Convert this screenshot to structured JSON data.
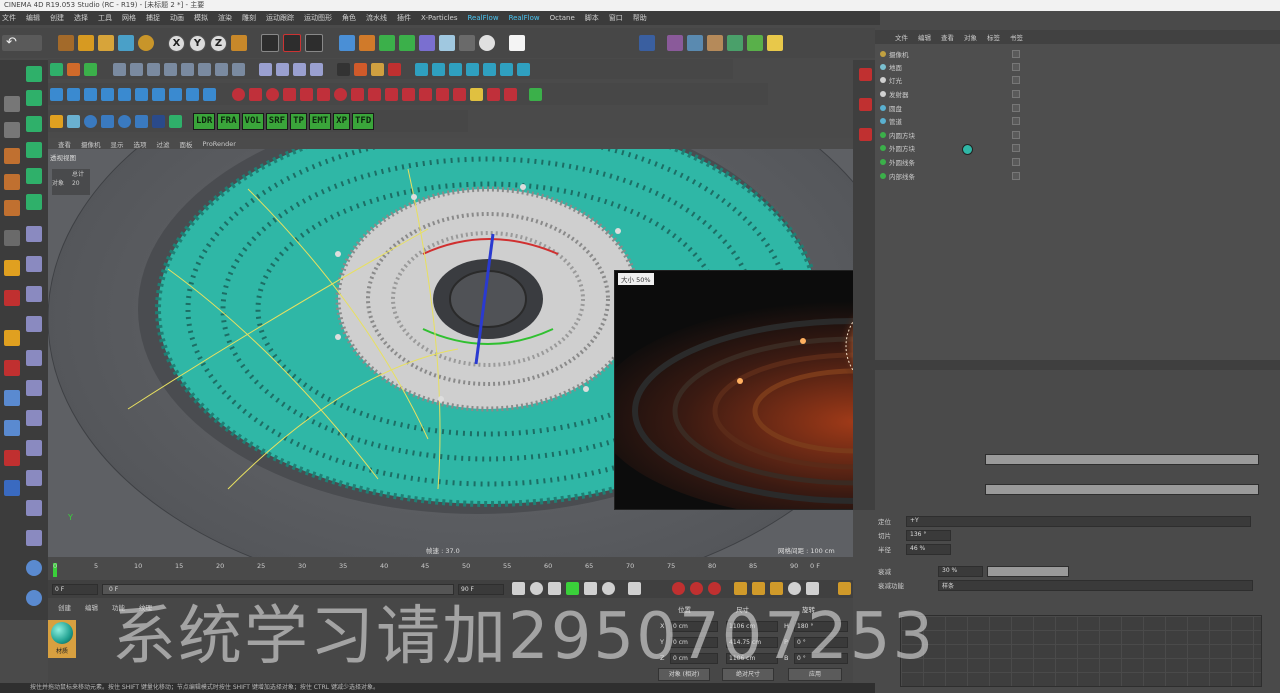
{
  "app": {
    "title": "CINEMA 4D R19.053 Studio (RC - R19) - [未标题 2 *] - 主要"
  },
  "menu": {
    "items": [
      "文件",
      "编辑",
      "创建",
      "选择",
      "工具",
      "网格",
      "捕捉",
      "动画",
      "模拟",
      "渲染",
      "雕刻",
      "运动跟踪",
      "运动图形",
      "角色",
      "流水线",
      "插件",
      "X-Particles",
      "RealFlow",
      "RealFlow",
      "Octane",
      "脚本",
      "窗口",
      "帮助"
    ]
  },
  "plugin_tags": [
    "LDR",
    "FRA",
    "VOL",
    "SRF",
    "TP",
    "EMT",
    "XP",
    "TFD"
  ],
  "axis_buttons": [
    "X",
    "Y",
    "Z"
  ],
  "viewport": {
    "menu": [
      "查看",
      "摄像机",
      "显示",
      "选项",
      "过滤",
      "面板",
      "ProRender"
    ],
    "view_label": "透视视图",
    "stats": {
      "label1": "总计",
      "label2": "对象",
      "value2": "20"
    },
    "speed_label": "帧速 : 37.0",
    "grid_label": "网格间距 : 100 cm",
    "axis_y": "Y"
  },
  "preview": {
    "label": "大小 50%"
  },
  "timeline": {
    "ticks": [
      "0",
      "5",
      "10",
      "15",
      "20",
      "25",
      "30",
      "35",
      "40",
      "45",
      "50",
      "55",
      "60",
      "65",
      "70",
      "75",
      "80",
      "85",
      "90"
    ],
    "end_frame": "0 F",
    "start_field": "0 F",
    "start_field2": "0 F",
    "end_field": "90 F"
  },
  "bottom": {
    "tabs": [
      "创建",
      "编辑",
      "功能",
      "纹理"
    ],
    "material_name": "材质",
    "coords": {
      "header": [
        "位置",
        "尺寸",
        "旋转"
      ],
      "rows": [
        {
          "axis": "X",
          "pos": "0 cm",
          "size": "1106 cm",
          "rot_label": "H",
          "rot": "180 °"
        },
        {
          "axis": "Y",
          "pos": "0 cm",
          "size": "414.75 cm",
          "rot_label": "P",
          "rot": "0 °"
        },
        {
          "axis": "Z",
          "pos": "0 cm",
          "size": "1106 cm",
          "rot_label": "B",
          "rot": "0 °"
        }
      ],
      "mode1": "对象 (相对)",
      "mode2": "绝对尺寸",
      "apply": "应用"
    }
  },
  "status_text": "按住并拖动鼠标来移动元素。按住 SHIFT 键量化移动；节点编辑模式时按住 SHIFT 键增加选择对象；按住 CTRL 键减少选择对象。",
  "object_manager": {
    "tabs": [
      "文件",
      "编辑",
      "查看",
      "对象",
      "标签",
      "书签"
    ],
    "objects": [
      "摄像机",
      "地面",
      "灯光",
      "发射器",
      "圆盘",
      "管道",
      "内圆方块",
      "外圆方块",
      "外圆线条",
      "内部线条"
    ]
  },
  "attributes": {
    "rows": [
      {
        "label": "定位",
        "value": "+Y"
      },
      {
        "label": "切片",
        "value": "136 °"
      },
      {
        "label": "半径",
        "value": "46 %"
      }
    ],
    "falloff_label": "衰减",
    "falloff_value": "30 %",
    "falloff_fn_label": "衰减功能",
    "falloff_fn_value": "样条"
  },
  "watermark": "系统学习请加2950707253",
  "colors": {
    "teal": "#2fb7a6",
    "accent_blue": "#49c3f0",
    "plugin_green": "#3aa53a"
  }
}
